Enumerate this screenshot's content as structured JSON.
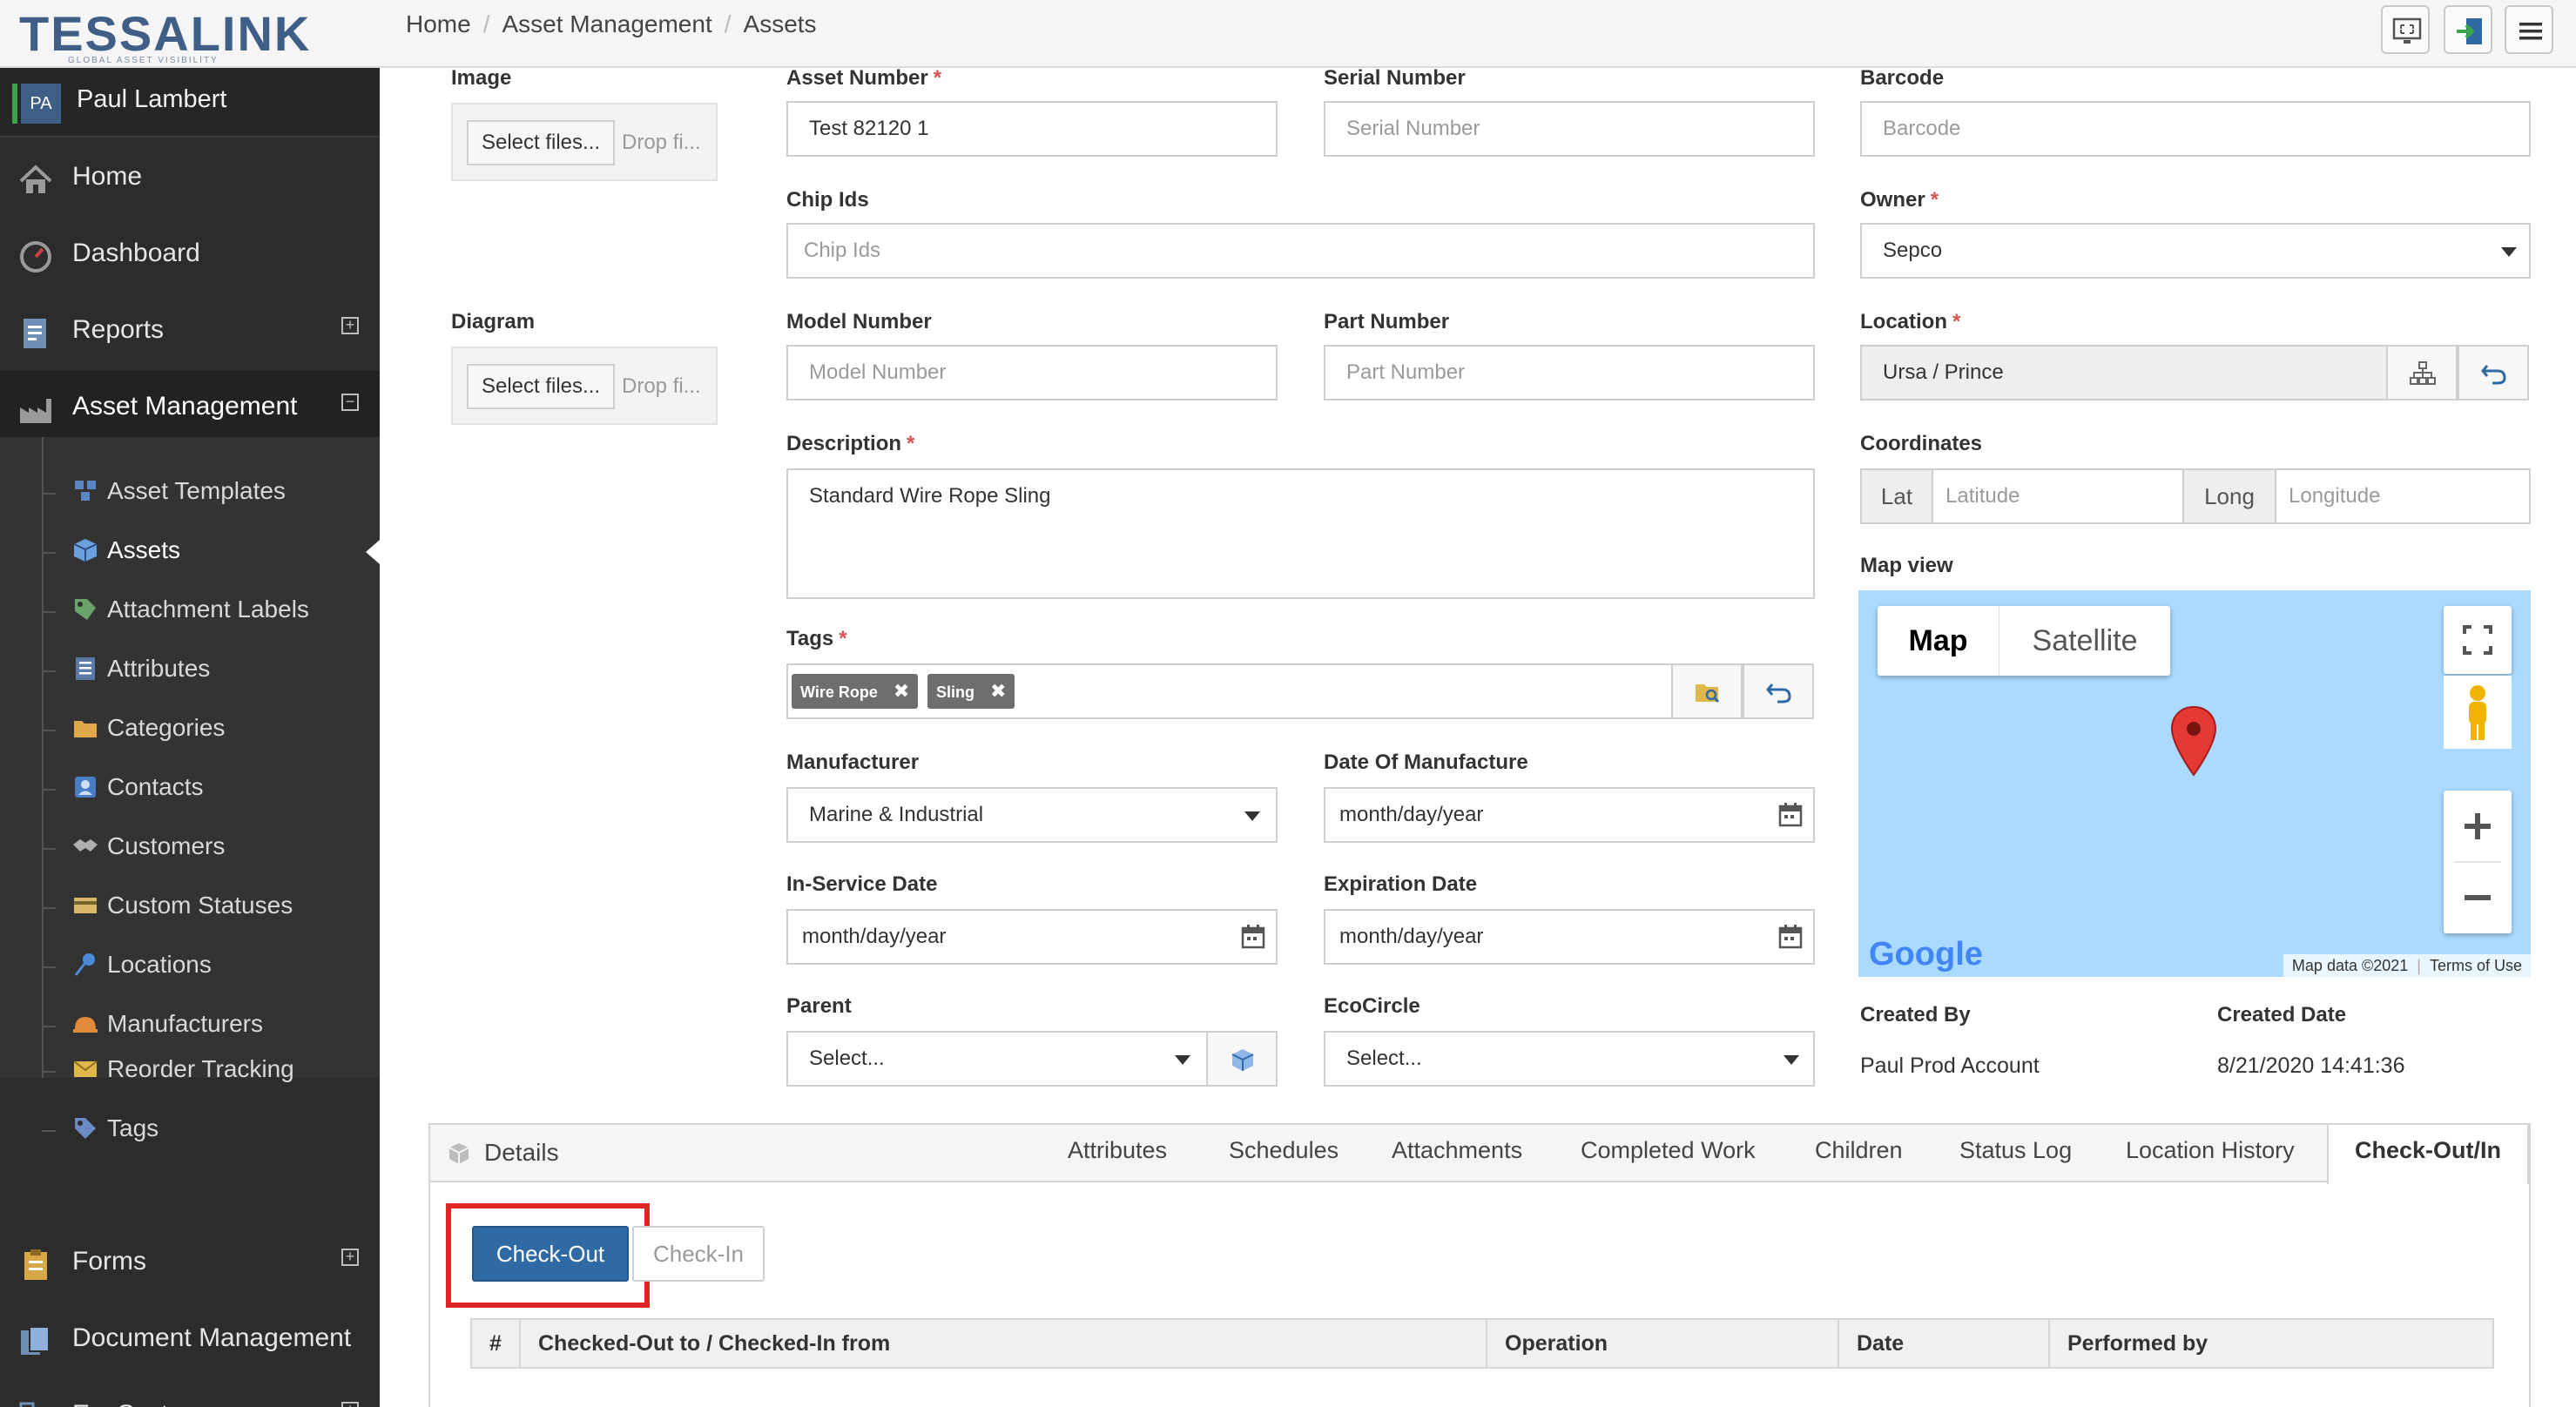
{
  "app": {
    "logo_text": "TESSALINK",
    "logo_tagline": "GLOBAL ASSET VISIBILITY",
    "breadcrumb": [
      "Home",
      "Asset Management",
      "Assets"
    ]
  },
  "user": {
    "initials": "PA",
    "name": "Paul Lambert"
  },
  "sidebar": {
    "items": [
      {
        "label": "Home",
        "icon": "home-icon"
      },
      {
        "label": "Dashboard",
        "icon": "gauge-icon"
      },
      {
        "label": "Reports",
        "icon": "report-icon",
        "expand": "+"
      },
      {
        "label": "Asset Management",
        "icon": "factory-icon",
        "expand": "−"
      }
    ],
    "submenu": [
      {
        "label": "Asset Templates",
        "icon": "cubes-icon"
      },
      {
        "label": "Assets",
        "icon": "cube-icon"
      },
      {
        "label": "Attachment Labels",
        "icon": "label-icon"
      },
      {
        "label": "Attributes",
        "icon": "list-icon"
      },
      {
        "label": "Categories",
        "icon": "folder-icon"
      },
      {
        "label": "Contacts",
        "icon": "contact-icon"
      },
      {
        "label": "Customers",
        "icon": "handshake-icon"
      },
      {
        "label": "Custom Statuses",
        "icon": "card-icon"
      },
      {
        "label": "Locations",
        "icon": "pin-icon"
      },
      {
        "label": "Manufacturers",
        "icon": "hardhat-icon"
      },
      {
        "label": "Reorder Tracking",
        "icon": "envelope-icon"
      },
      {
        "label": "Tags",
        "icon": "tag-icon"
      }
    ],
    "bottom_items": [
      {
        "label": "Forms",
        "icon": "clipboard-icon",
        "expand": "+"
      },
      {
        "label": "Document Management",
        "icon": "documents-icon"
      },
      {
        "label": "EcoSystem",
        "icon": "network-icon",
        "expand": "+"
      }
    ]
  },
  "form": {
    "image": {
      "label": "Image",
      "button": "Select files...",
      "drop": "Drop fi..."
    },
    "diagram": {
      "label": "Diagram",
      "button": "Select files...",
      "drop": "Drop fi..."
    },
    "asset_number": {
      "label": "Asset Number",
      "required": "*",
      "value": "Test 82120 1"
    },
    "serial_number": {
      "label": "Serial Number",
      "placeholder": "Serial Number"
    },
    "barcode": {
      "label": "Barcode",
      "placeholder": "Barcode"
    },
    "chip_ids": {
      "label": "Chip Ids",
      "placeholder": "Chip Ids"
    },
    "owner": {
      "label": "Owner",
      "required": "*",
      "value": "Sepco"
    },
    "model_number": {
      "label": "Model Number",
      "placeholder": "Model Number"
    },
    "part_number": {
      "label": "Part Number",
      "placeholder": "Part Number"
    },
    "location": {
      "label": "Location",
      "required": "*",
      "value": "Ursa / Prince"
    },
    "description": {
      "label": "Description",
      "required": "*",
      "value": "Standard Wire Rope Sling"
    },
    "coordinates": {
      "label": "Coordinates",
      "lat_addon": "Lat",
      "lat_placeholder": "Latitude",
      "long_addon": "Long",
      "long_placeholder": "Longitude"
    },
    "map_view": {
      "label": "Map view",
      "tab_map": "Map",
      "tab_satellite": "Satellite",
      "attribution": "Map data ©2021",
      "terms": "Terms of Use",
      "google": "Google"
    },
    "tags": {
      "label": "Tags",
      "required": "*",
      "items": [
        "Wire Rope",
        "Sling"
      ],
      "remove": "✖"
    },
    "manufacturer": {
      "label": "Manufacturer",
      "value": "Marine & Industrial"
    },
    "date_of_manufacture": {
      "label": "Date Of Manufacture",
      "value": "month/day/year"
    },
    "in_service_date": {
      "label": "In-Service Date",
      "value": "month/day/year"
    },
    "expiration_date": {
      "label": "Expiration Date",
      "value": "month/day/year"
    },
    "parent": {
      "label": "Parent",
      "value": "Select..."
    },
    "ecocircle": {
      "label": "EcoCircle",
      "value": "Select..."
    },
    "created_by": {
      "label": "Created By",
      "value": "Paul Prod Account"
    },
    "created_date": {
      "label": "Created Date",
      "value": "8/21/2020 14:41:36"
    }
  },
  "details": {
    "title": "Details",
    "tabs": [
      "Attributes",
      "Schedules",
      "Attachments",
      "Completed Work",
      "Children",
      "Status Log",
      "Location History",
      "Check-Out/In"
    ],
    "active_tab": "Check-Out/In",
    "checkout_label": "Check-Out",
    "checkin_label": "Check-In",
    "table_headers": [
      "#",
      "Checked-Out to / Checked-In from",
      "Operation",
      "Date",
      "Performed by"
    ]
  },
  "colors": {
    "sidebar_bg": "#2c2c2c",
    "primary": "#2f6aa5",
    "required": "#d9534f",
    "highlight": "#e02525",
    "map_water": "#aadaff"
  }
}
